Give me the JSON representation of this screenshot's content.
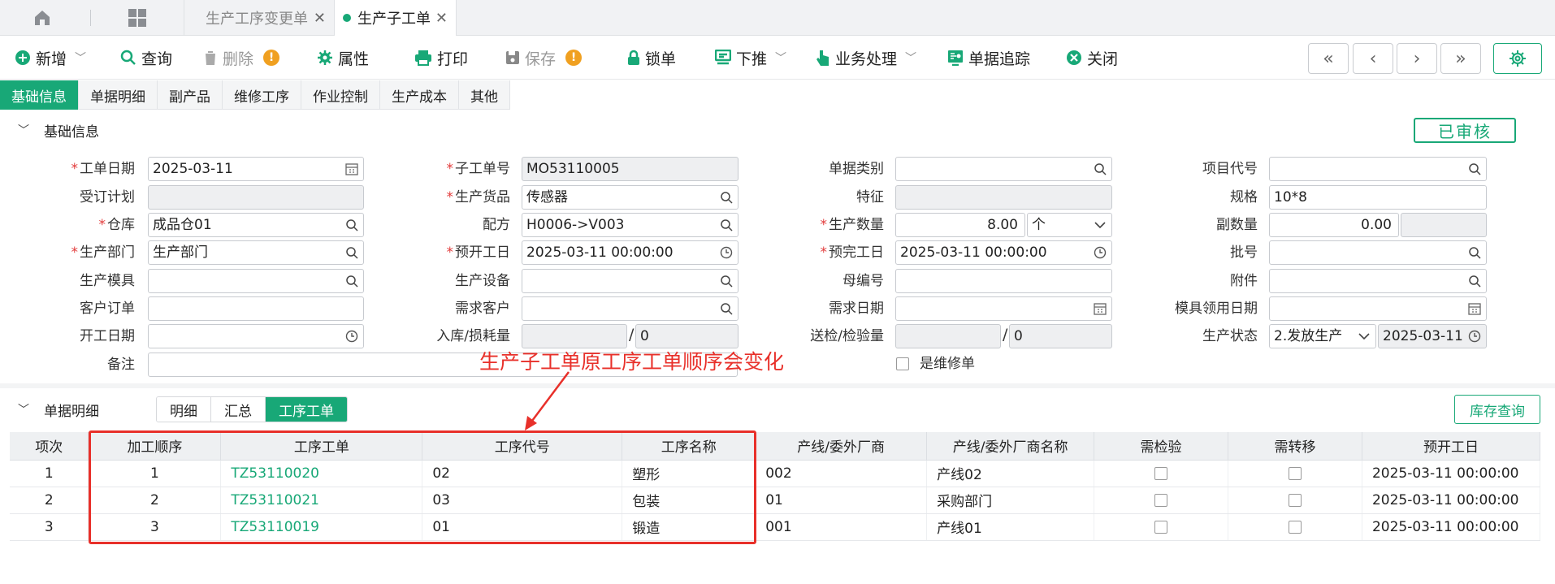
{
  "tabs": {
    "tab1": "生产工序变更单",
    "tab2": "生产子工单",
    "close": "✕"
  },
  "toolbar": {
    "new": "新增",
    "query": "查询",
    "delete": "删除",
    "attr": "属性",
    "print": "打印",
    "save": "保存",
    "lock": "锁单",
    "push": "下推",
    "business": "业务处理",
    "trace": "单据追踪",
    "close": "关闭",
    "warn": "!",
    "caret": "﹀",
    "nav_first": "«",
    "nav_prev": "‹",
    "nav_next": "›",
    "nav_last": "»"
  },
  "subtabs": [
    "基础信息",
    "单据明细",
    "副产品",
    "维修工序",
    "作业控制",
    "生产成本",
    "其他"
  ],
  "section_basic": {
    "title": "基础信息",
    "status": "已审核",
    "chevron": "﹀"
  },
  "form": {
    "work_date": {
      "label": "工单日期",
      "value": "2025-03-11"
    },
    "order_plan": {
      "label": "受订计划",
      "value": ""
    },
    "warehouse": {
      "label": "仓库",
      "value": "成品仓01"
    },
    "dept": {
      "label": "生产部门",
      "value": "生产部门"
    },
    "mold": {
      "label": "生产模具",
      "value": ""
    },
    "cust_order": {
      "label": "客户订单",
      "value": ""
    },
    "start_date": {
      "label": "开工日期",
      "value": ""
    },
    "remark": {
      "label": "备注",
      "value": ""
    },
    "sub_no": {
      "label": "子工单号",
      "value": "MO53110005"
    },
    "product": {
      "label": "生产货品",
      "value": "传感器"
    },
    "recipe": {
      "label": "配方",
      "value": "H0006->V003"
    },
    "plan_start": {
      "label": "预开工日",
      "value": "2025-03-11 00:00:00"
    },
    "equipment": {
      "label": "生产设备",
      "value": ""
    },
    "demand_cust": {
      "label": "需求客户",
      "value": ""
    },
    "instock": {
      "label": "入库/损耗量",
      "value": "",
      "value2": "0"
    },
    "doc_type": {
      "label": "单据类别",
      "value": ""
    },
    "feature": {
      "label": "特征",
      "value": ""
    },
    "qty": {
      "label": "生产数量",
      "value": "8.00",
      "unit": "个"
    },
    "plan_end": {
      "label": "预完工日",
      "value": "2025-03-11 00:00:00"
    },
    "parent_no": {
      "label": "母编号",
      "value": ""
    },
    "demand_date": {
      "label": "需求日期",
      "value": ""
    },
    "inspect": {
      "label": "送检/检验量",
      "value": "",
      "value2": "0"
    },
    "repair": {
      "label": "是维修单"
    },
    "project": {
      "label": "项目代号",
      "value": ""
    },
    "spec": {
      "label": "规格",
      "value": "10*8"
    },
    "sub_qty": {
      "label": "副数量",
      "value": "0.00",
      "value2": ""
    },
    "batch": {
      "label": "批号",
      "value": ""
    },
    "attach": {
      "label": "附件",
      "value": ""
    },
    "mold_date": {
      "label": "模具领用日期",
      "value": ""
    },
    "prod_status": {
      "label": "生产状态",
      "value": "2.发放生产",
      "date": "2025-03-11"
    },
    "slash": "/",
    "required_mark": "*"
  },
  "annotation": "生产子工单原工序工单顺序会变化",
  "section_detail": {
    "title": "单据明细",
    "chevron": "﹀",
    "views": [
      "明细",
      "汇总",
      "工序工单"
    ],
    "stock_query": "库存查询"
  },
  "table": {
    "headers": [
      "项次",
      "加工顺序",
      "工序工单",
      "工序代号",
      "工序名称",
      "产线/委外厂商",
      "产线/委外厂商名称",
      "需检验",
      "需转移",
      "预开工日"
    ],
    "rows": [
      {
        "idx": "1",
        "seq": "1",
        "order": "TZ53110020",
        "code": "02",
        "name": "塑形",
        "line": "002",
        "line_name": "产线02",
        "start": "2025-03-11 00:00:00"
      },
      {
        "idx": "2",
        "seq": "2",
        "order": "TZ53110021",
        "code": "03",
        "name": "包装",
        "line": "01",
        "line_name": "采购部门",
        "start": "2025-03-11 00:00:00"
      },
      {
        "idx": "3",
        "seq": "3",
        "order": "TZ53110019",
        "code": "01",
        "name": "锻造",
        "line": "001",
        "line_name": "产线01",
        "start": "2025-03-11 00:00:00"
      }
    ]
  },
  "colors": {
    "accent": "#18a877",
    "annotation": "#e8302a",
    "warn": "#f0a020"
  }
}
